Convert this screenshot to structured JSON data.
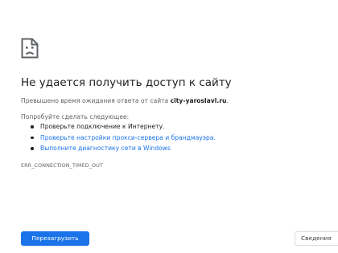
{
  "error": {
    "icon": "sad-document-icon",
    "title": "Не удается получить доступ к сайту",
    "summary_prefix": "Превышено время ожидания ответа от сайта ",
    "host": "city-yaroslavl.ru",
    "summary_suffix": ".",
    "suggestions_title": "Попробуйте сделать следующее:",
    "suggestions": [
      "Проверьте подключение к Интернету.",
      "Проверьте настройки прокси-сервера и брандмауэра.",
      "Выполните диагностику сети в Windows"
    ],
    "code": "ERR_CONNECTION_TIMED_OUT"
  },
  "buttons": {
    "reload": "Перезагрузить",
    "details": "Сведения"
  },
  "colors": {
    "primary": "#1a73e8",
    "link": "#1a73e8",
    "text": "#202124",
    "secondary_text": "#5f6368",
    "border": "#dadce0"
  }
}
